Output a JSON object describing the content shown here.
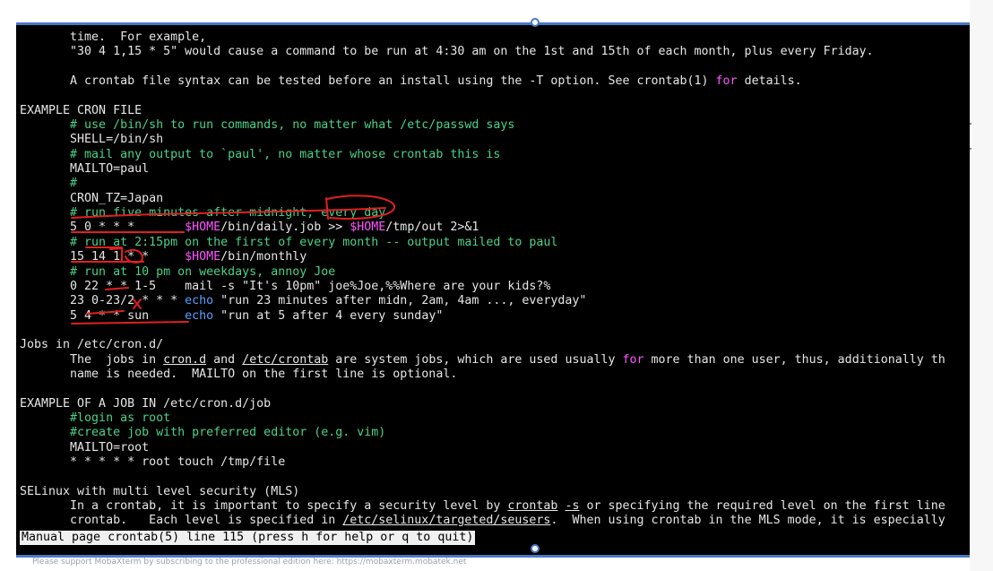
{
  "terminal": {
    "lines": [
      [
        {
          "t": "       time.  For example,"
        }
      ],
      [
        {
          "t": "       \"30 4 1,15 * 5\" would cause a command to be run at 4:30 am on the 1st and 15th of each month, plus every Friday."
        }
      ],
      [
        {
          "t": ""
        }
      ],
      [
        {
          "t": "       A crontab file syntax can be tested before an install using the -T option. See crontab(1) "
        },
        {
          "t": "for",
          "c": "v"
        },
        {
          "t": " details."
        }
      ],
      [
        {
          "t": ""
        }
      ],
      [
        {
          "t": "EXAMPLE CRON FILE"
        }
      ],
      [
        {
          "t": "       # use /bin/sh to run commands, no matter what /etc/passwd says",
          "c": "c"
        }
      ],
      [
        {
          "t": "       SHELL=/bin/sh"
        }
      ],
      [
        {
          "t": "       # mail any output to `paul', no matter whose crontab this is",
          "c": "c"
        }
      ],
      [
        {
          "t": "       MAILTO=paul"
        }
      ],
      [
        {
          "t": "       #",
          "c": "c"
        }
      ],
      [
        {
          "t": "       CRON_TZ=Japan"
        }
      ],
      [
        {
          "t": "       # run five minutes after midnight, every day",
          "c": "c"
        }
      ],
      [
        {
          "t": "       5 0 * * *       "
        },
        {
          "t": "$HOME",
          "c": "v"
        },
        {
          "t": "/bin/daily.job >> "
        },
        {
          "t": "$HOME",
          "c": "v"
        },
        {
          "t": "/tmp/out 2>&1"
        }
      ],
      [
        {
          "t": "       # run at 2:15pm on the first of every month -- output mailed to paul",
          "c": "c"
        }
      ],
      [
        {
          "t": "       15 14 1 * *     "
        },
        {
          "t": "$HOME",
          "c": "v"
        },
        {
          "t": "/bin/monthly"
        }
      ],
      [
        {
          "t": "       # run at 10 pm on weekdays, annoy Joe",
          "c": "c"
        }
      ],
      [
        {
          "t": "       0 22 * * 1-5    mail -s \"It's 10pm\" joe%Joe,%%Where are your kids?%"
        }
      ],
      [
        {
          "t": "       23 0-23/2 * * * "
        },
        {
          "t": "echo",
          "c": "b"
        },
        {
          "t": " \"run 23 minutes after midn, 2am, 4am ..., everyday\""
        }
      ],
      [
        {
          "t": "       5 4 * * sun     "
        },
        {
          "t": "echo",
          "c": "b"
        },
        {
          "t": " \"run at 5 after 4 every sunday\""
        }
      ],
      [
        {
          "t": ""
        }
      ],
      [
        {
          "t": "Jobs in /etc/cron.d/"
        }
      ],
      [
        {
          "t": "       The  jobs in "
        },
        {
          "t": "cron.d",
          "u": true
        },
        {
          "t": " and "
        },
        {
          "t": "/etc/crontab",
          "u": true
        },
        {
          "t": " are system jobs, which are used usually "
        },
        {
          "t": "for",
          "c": "v"
        },
        {
          "t": " more than one user, thus, additionally th"
        }
      ],
      [
        {
          "t": "       name is needed.  MAILTO on the first line is optional."
        }
      ],
      [
        {
          "t": ""
        }
      ],
      [
        {
          "t": "EXAMPLE OF A JOB IN /etc/cron.d/job"
        }
      ],
      [
        {
          "t": "       #login as root",
          "c": "c"
        }
      ],
      [
        {
          "t": "       #create job with preferred editor (e.g. vim)",
          "c": "c"
        }
      ],
      [
        {
          "t": "       MAILTO=root"
        }
      ],
      [
        {
          "t": "       * * * * * root touch /tmp/file"
        }
      ],
      [
        {
          "t": ""
        }
      ],
      [
        {
          "t": "SELinux with multi level security (MLS)"
        }
      ],
      [
        {
          "t": "       In a crontab, it is important to specify a security level by "
        },
        {
          "t": "crontab",
          "u": true
        },
        {
          "t": " "
        },
        {
          "t": "-s",
          "u": true
        },
        {
          "t": " or specifying the required level on the first line"
        }
      ],
      [
        {
          "t": "       crontab.   Each level is specified in "
        },
        {
          "t": "/etc/selinux/targeted/seusers",
          "u": true
        },
        {
          "t": ".  When using crontab in the MLS mode, it is especially"
        }
      ]
    ],
    "status_line": "Manual page crontab(5) line 115 (press h for help or q to quit)"
  },
  "footer_text": "Please support MobaXterm by subscribing to the professional edition here:  https://mobaxterm.mobatek.net",
  "colors": {
    "background": "#000000",
    "text": "#e6e6e6",
    "comment": "#4ad28a",
    "variable": "#ff55ff",
    "builtin": "#5aa0ff",
    "annotation": "#e02020",
    "window_border": "#4a78c8"
  }
}
